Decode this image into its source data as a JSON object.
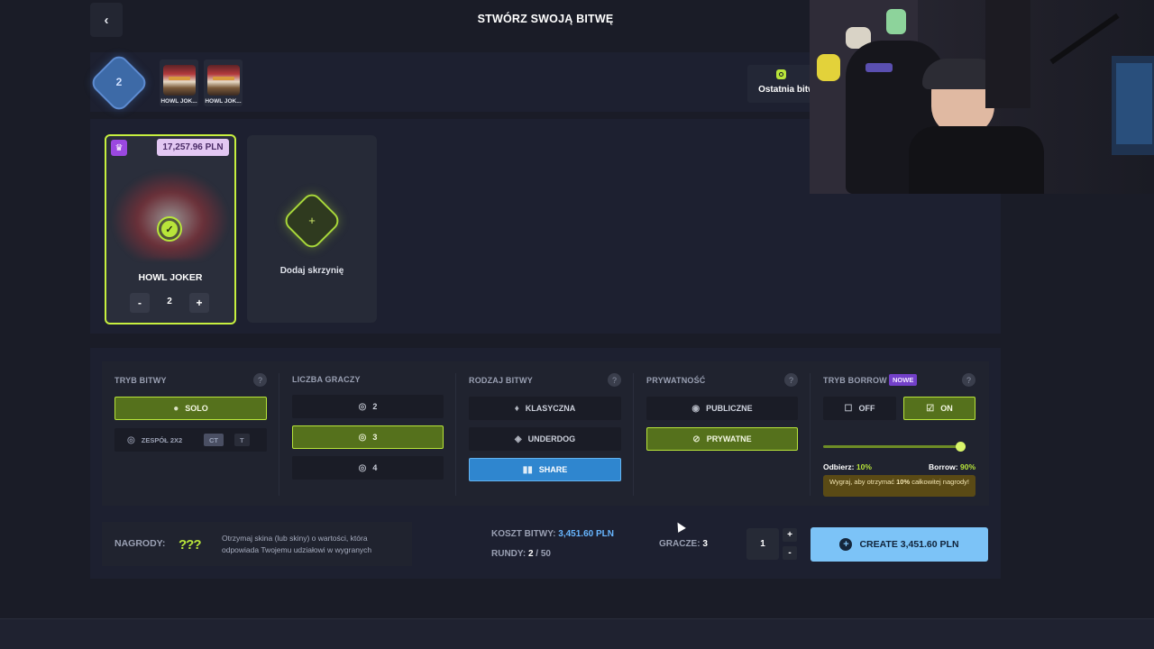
{
  "header": {
    "title": "STWÓRZ SWOJĄ BITWĘ",
    "back_icon": "‹"
  },
  "case_strip": {
    "round_count": "2",
    "thumbs": [
      {
        "label": "HOWL JOK..."
      },
      {
        "label": "HOWL JOK..."
      }
    ],
    "recent_label": "Ostatnia bitw"
  },
  "case_card": {
    "price": "17,257.96 PLN",
    "name": "HOWL JOKER",
    "quantity": "2",
    "minus": "-",
    "plus": "+",
    "crown_icon": "♛",
    "check_icon": "✓"
  },
  "add_case": {
    "plus": "+",
    "label": "Dodaj skrzynię"
  },
  "settings": {
    "mode": {
      "title": "TRYB BITWY",
      "solo": "SOLO",
      "team": "ZESPÓŁ 2X2",
      "ct": "CT",
      "t": "T"
    },
    "players": {
      "title": "LICZBA GRACZY",
      "options": [
        "2",
        "3",
        "4"
      ],
      "selected": "3"
    },
    "type": {
      "title": "RODZAJ BITWY",
      "classic": "KLASYCZNA",
      "underdog": "UNDERDOG",
      "share": "SHARE"
    },
    "privacy": {
      "title": "PRYWATNOŚĆ",
      "public": "PUBLICZNE",
      "private": "PRYWATNE"
    },
    "borrow": {
      "title": "TRYB BORROW",
      "badge": "NOWE",
      "off": "OFF",
      "on": "ON",
      "slider_value": 0.9,
      "receive_label": "Odbierz:",
      "receive_value": "10%",
      "borrow_label": "Borrow:",
      "borrow_value": "90%",
      "note_pre": "Wygraj, aby otrzymać ",
      "note_bold": "10%",
      "note_post": " całkowitej nagrody!"
    },
    "help": "?"
  },
  "footer": {
    "rewards_label": "NAGRODY:",
    "rewards_icon": "???",
    "rewards_text": "Otrzymaj skina (lub skiny) o wartości, która odpowiada Twojemu udziałowi w wygranych",
    "cost_label": "KOSZT BITWY:",
    "cost_value": "3,451.60 PLN",
    "rounds_label": "RUNDY:",
    "rounds_value": "2",
    "rounds_total": " / 50",
    "players_label": "GRACZE:",
    "players_value": "3",
    "count": "1",
    "inc": "+",
    "dec": "-",
    "create_label": "CREATE 3,451.60 PLN",
    "create_icon": "+"
  },
  "colors": {
    "accent": "#b8e53a",
    "create": "#7cc3f7",
    "share": "#2f86cf",
    "badge": "#7340c9"
  }
}
